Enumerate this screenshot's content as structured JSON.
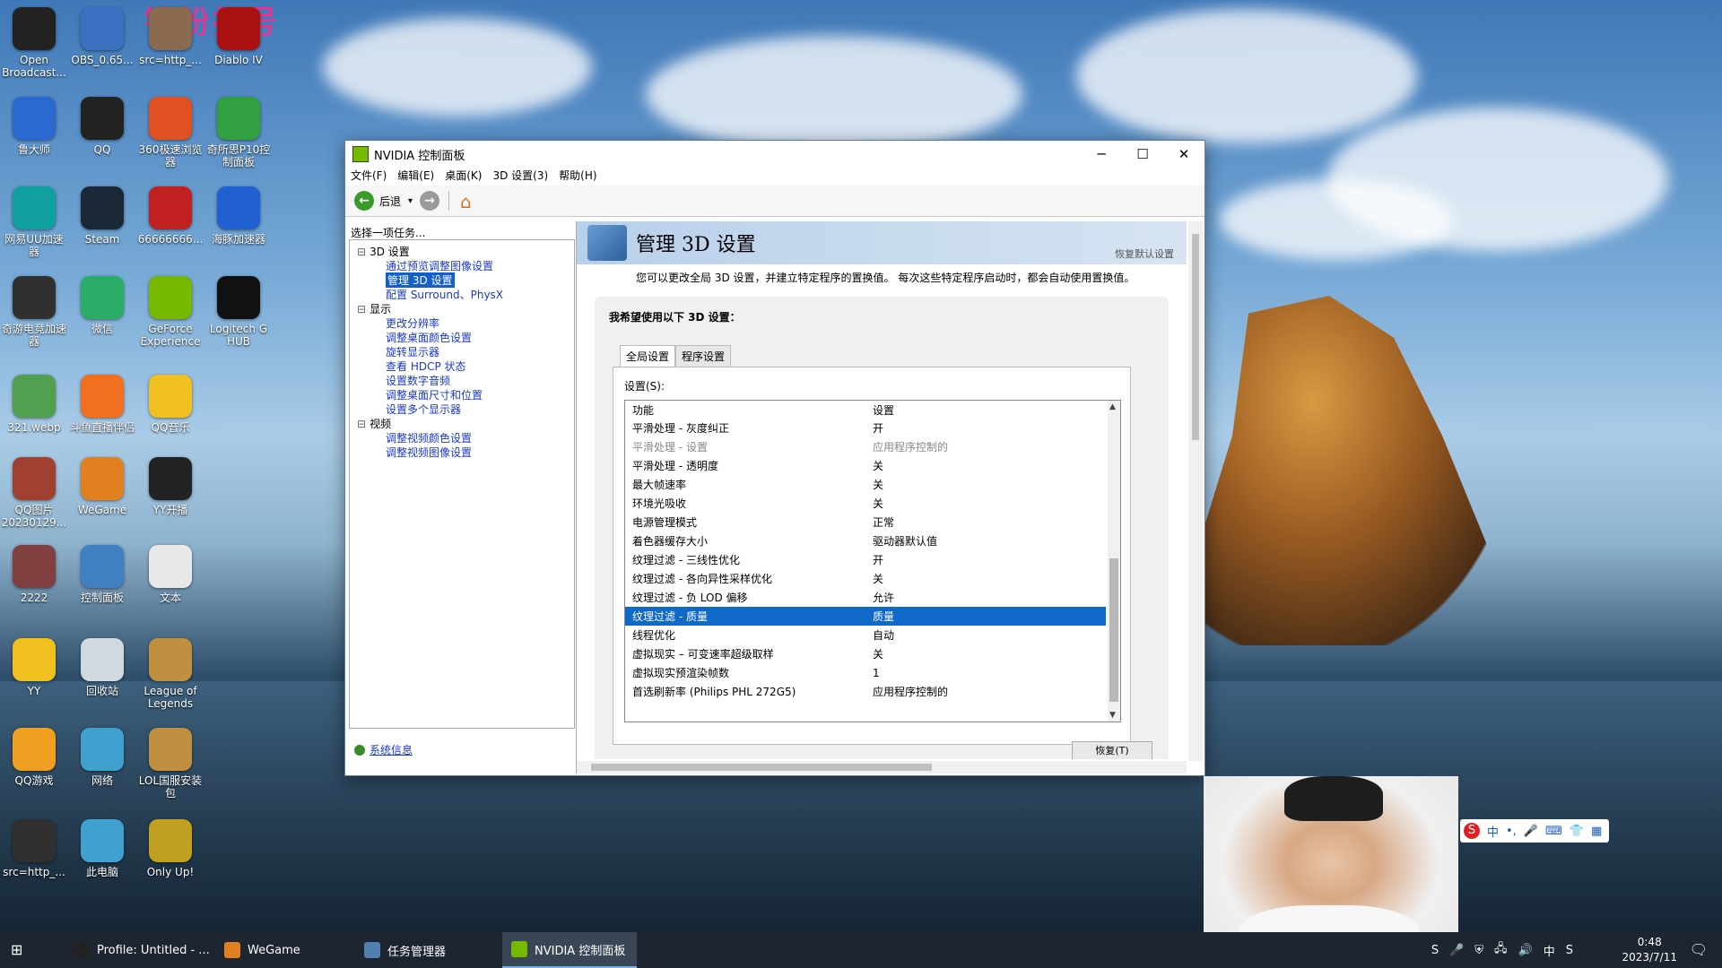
{
  "watermark": "钻粉打号",
  "desktop_icons": [
    {
      "label": "Open Broadcast...",
      "color": "#222"
    },
    {
      "label": "OBS_0.65...",
      "color": "#3a70c0"
    },
    {
      "label": "src=http_...",
      "color": "#8a6a50"
    },
    {
      "label": "Diablo IV",
      "color": "#aa1010"
    },
    {
      "label": "鲁大师",
      "color": "#2a6ad0"
    },
    {
      "label": "QQ",
      "color": "#222"
    },
    {
      "label": "360极速浏览器",
      "color": "#e05020"
    },
    {
      "label": "奇所思P10控制面板",
      "color": "#30a040"
    },
    {
      "label": "网易UU加速器",
      "color": "#10a0a0"
    },
    {
      "label": "Steam",
      "color": "#1b2838"
    },
    {
      "label": "66666666...",
      "color": "#c02020"
    },
    {
      "label": "海豚加速器",
      "color": "#2060d0"
    },
    {
      "label": "奇游电竞加速器",
      "color": "#303030"
    },
    {
      "label": "微信",
      "color": "#2aae67"
    },
    {
      "label": "GeForce Experience",
      "color": "#76b900"
    },
    {
      "label": "Logitech G HUB",
      "color": "#111"
    },
    {
      "label": "321.webp",
      "color": "#50a050"
    },
    {
      "label": "斗鱼直播伴侣",
      "color": "#f07020"
    },
    {
      "label": "QQ音乐",
      "color": "#f0c020"
    },
    {
      "label": "QQ图片20230129...",
      "color": "#a04030"
    },
    {
      "label": "WeGame",
      "color": "#e08020"
    },
    {
      "label": "YY开播",
      "color": "#222"
    },
    {
      "label": "2222",
      "color": "#804040"
    },
    {
      "label": "控制面板",
      "color": "#4080c0"
    },
    {
      "label": "文本",
      "color": "#e8e8e8"
    },
    {
      "label": "YY",
      "color": "#f0c020"
    },
    {
      "label": "回收站",
      "color": "#d0d8e0"
    },
    {
      "label": "League of Legends",
      "color": "#c09040"
    },
    {
      "label": "QQ游戏",
      "color": "#f0a020"
    },
    {
      "label": "网络",
      "color": "#40a0d0"
    },
    {
      "label": "LOL国服安装包",
      "color": "#c09040"
    },
    {
      "label": "src=http_...",
      "color": "#303030"
    },
    {
      "label": "此电脑",
      "color": "#40a0d0"
    },
    {
      "label": "Only Up!",
      "color": "#c0a020"
    }
  ],
  "window": {
    "title": "NVIDIA 控制面板",
    "minimize": "─",
    "maximize": "☐",
    "close": "✕",
    "menu": [
      "文件(F)",
      "编辑(E)",
      "桌面(K)",
      "3D 设置(3)",
      "帮助(H)"
    ],
    "toolbar": {
      "back": "后退",
      "back_arrow": "←",
      "forward_arrow": "→",
      "dropdown": "▾",
      "home": "⌂"
    },
    "left": {
      "task_title": "选择一项任务...",
      "tree": [
        {
          "type": "cat",
          "label": "3D 设置"
        },
        {
          "type": "item",
          "label": "通过预览调整图像设置"
        },
        {
          "type": "item",
          "label": "管理 3D 设置",
          "selected": true
        },
        {
          "type": "item",
          "label": "配置 Surround、PhysX"
        },
        {
          "type": "cat",
          "label": "显示"
        },
        {
          "type": "item",
          "label": "更改分辨率"
        },
        {
          "type": "item",
          "label": "调整桌面颜色设置"
        },
        {
          "type": "item",
          "label": "旋转显示器"
        },
        {
          "type": "item",
          "label": "查看 HDCP 状态"
        },
        {
          "type": "item",
          "label": "设置数字音频"
        },
        {
          "type": "item",
          "label": "调整桌面尺寸和位置"
        },
        {
          "type": "item",
          "label": "设置多个显示器"
        },
        {
          "type": "cat",
          "label": "视频"
        },
        {
          "type": "item",
          "label": "调整视频颜色设置"
        },
        {
          "type": "item",
          "label": "调整视频图像设置"
        }
      ],
      "system_info": "系统信息"
    },
    "right": {
      "heading": "管理 3D 设置",
      "restore_defaults": "恢复默认设置",
      "description": "您可以更改全局 3D 设置，并建立特定程序的置换值。 每次这些特定程序启动时，都会自动使用置换值。",
      "group_title": "我希望使用以下 3D 设置：",
      "tabs": [
        "全局设置",
        "程序设置"
      ],
      "settings_label": "设置(S):",
      "columns": [
        "功能",
        "设置"
      ],
      "rows": [
        {
          "feature": "平滑处理 - 灰度纠正",
          "value": "开"
        },
        {
          "feature": "平滑处理 - 设置",
          "value": "应用程序控制的",
          "dim": true
        },
        {
          "feature": "平滑处理 - 透明度",
          "value": "关"
        },
        {
          "feature": "最大帧速率",
          "value": "关"
        },
        {
          "feature": "环境光吸收",
          "value": "关"
        },
        {
          "feature": "电源管理模式",
          "value": "正常"
        },
        {
          "feature": "着色器缓存大小",
          "value": "驱动器默认值"
        },
        {
          "feature": "纹理过滤 - 三线性优化",
          "value": "开"
        },
        {
          "feature": "纹理过滤 - 各向异性采样优化",
          "value": "关"
        },
        {
          "feature": "纹理过滤 - 负 LOD 偏移",
          "value": "允许"
        },
        {
          "feature": "纹理过滤 - 质量",
          "value": "质量",
          "selected": true
        },
        {
          "feature": "线程优化",
          "value": "自动"
        },
        {
          "feature": "虚拟现实 – 可变速率超级取样",
          "value": "关"
        },
        {
          "feature": "虚拟现实预渲染帧数",
          "value": "1"
        },
        {
          "feature": "首选刷新率 (Philips PHL 272G5)",
          "value": "应用程序控制的"
        }
      ],
      "restore_button": "恢复(T)"
    }
  },
  "ime": {
    "logo": "S",
    "items": [
      "中",
      "•,",
      "🎤",
      "⌨",
      "👕",
      "▦"
    ]
  },
  "taskbar": {
    "start": "⊞",
    "items": [
      {
        "label": "Profile: Untitled - ...",
        "color": "#222"
      },
      {
        "label": "WeGame",
        "color": "#e08020"
      },
      {
        "label": "任务管理器",
        "color": "#5080b0"
      },
      {
        "label": "NVIDIA 控制面板",
        "color": "#76b900",
        "active": true
      }
    ],
    "tray": [
      "S",
      "🎤",
      "⛨",
      "🖧",
      "🔊",
      "中",
      "S"
    ],
    "time": "0:48",
    "date": "2023/7/11",
    "notification": "🗨"
  }
}
